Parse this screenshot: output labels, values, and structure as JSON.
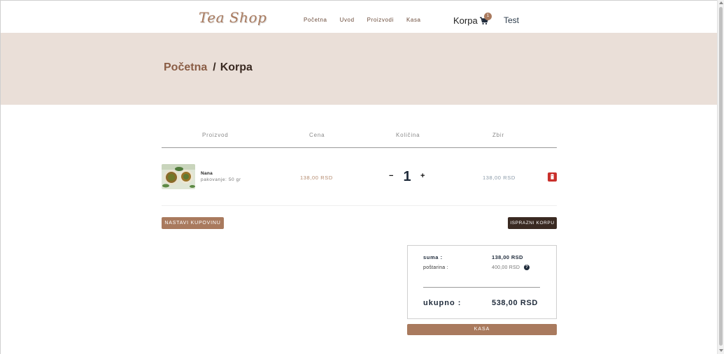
{
  "brand": {
    "name": "Tea Shop"
  },
  "nav": {
    "items": [
      {
        "label": "Početna"
      },
      {
        "label": "Uvod"
      },
      {
        "label": "Proizvodi"
      },
      {
        "label": "Kasa"
      }
    ],
    "cart_label": "Korpa",
    "cart_icon": "shopping-cart-icon",
    "cart_count": "1",
    "user_label": "Test"
  },
  "breadcrumb": {
    "home": "Početna",
    "current": "Korpa"
  },
  "table": {
    "columns": [
      "Proizvod",
      "Cena",
      "Količina",
      "Zbir"
    ],
    "rows": [
      {
        "name": "Nana",
        "desc": "pakovanje: 50 gr",
        "price": "138,00 RSD",
        "quantity": "1",
        "total": "138,00 RSD"
      }
    ]
  },
  "actions": {
    "continue_label": "NASTAVI KUPOVINU",
    "empty_label": "ISPRAZNI KORPU"
  },
  "summary": {
    "sum_label": "suma :",
    "sum_value": "138,00 RSD",
    "postage_label": "poštarina :",
    "postage_value": "400,00 RSD",
    "total_label": "ukupno :",
    "total_value": "538,00 RSD",
    "checkout_label": "KASA"
  },
  "colors": {
    "accent": "#a97a5e",
    "dark": "#3a2a22",
    "hero_bg": "#eadfd8",
    "danger": "#c9302c",
    "navy": "#1e2a3a"
  }
}
